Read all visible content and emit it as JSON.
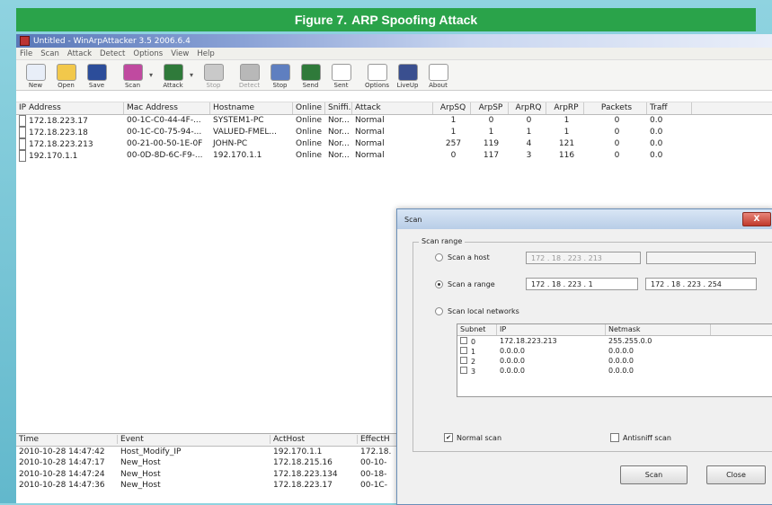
{
  "figure": {
    "label": "Figure 7.",
    "title": "ARP Spoofing Attack"
  },
  "app": {
    "title": "Untitled - WinArpAttacker 3.5 2006.6.4",
    "menu": [
      "File",
      "Scan",
      "Attack",
      "Detect",
      "Options",
      "View",
      "Help"
    ],
    "toolbar": [
      {
        "label": "New",
        "icon": "new-icon",
        "color": "#e8eef8"
      },
      {
        "label": "Open",
        "icon": "open-folder-icon",
        "color": "#f2c84b"
      },
      {
        "label": "Save",
        "icon": "save-icon",
        "color": "#2c4d9a"
      },
      {
        "label": "Scan",
        "icon": "scan-icon",
        "color": "#c04aa0"
      },
      {
        "label": "Attack",
        "icon": "attack-icon",
        "color": "#2f7a3a"
      },
      {
        "label": "Stop",
        "icon": "stop-icon",
        "color": "#c9c9c9"
      },
      {
        "label": "Detect",
        "icon": "detect-icon",
        "color": "#b8b8b8"
      },
      {
        "label": "Stop",
        "icon": "stop-detect-icon",
        "color": "#5f7fc0"
      },
      {
        "label": "Send",
        "icon": "send-icon",
        "color": "#2f7a3a"
      },
      {
        "label": "Sent",
        "icon": "sent-icon",
        "color": "#ffffff"
      },
      {
        "label": "Options",
        "icon": "options-icon",
        "color": "#ffffff"
      },
      {
        "label": "LiveUp",
        "icon": "liveup-icon",
        "color": "#3a4f8f"
      },
      {
        "label": "About",
        "icon": "about-icon",
        "color": "#ffffff"
      }
    ]
  },
  "hosts": {
    "columns": [
      "IP Address",
      "Mac Address",
      "Hostname",
      "Online",
      "Sniffi...",
      "Attack",
      "ArpSQ",
      "ArpSP",
      "ArpRQ",
      "ArpRP",
      "Packets",
      "Traff"
    ],
    "rows": [
      {
        "ip": "172.18.223.17",
        "mac": "00-1C-C0-44-4F-...",
        "host": "SYSTEM1-PC",
        "online": "Online",
        "sniff": "Nor...",
        "attack": "Normal",
        "sq": "1",
        "sp": "0",
        "rq": "0",
        "rp": "1",
        "pk": "0",
        "tr": "0.0"
      },
      {
        "ip": "172.18.223.18",
        "mac": "00-1C-C0-75-94-...",
        "host": "VALUED-FMEL...",
        "online": "Online",
        "sniff": "Nor...",
        "attack": "Normal",
        "sq": "1",
        "sp": "1",
        "rq": "1",
        "rp": "1",
        "pk": "0",
        "tr": "0.0"
      },
      {
        "ip": "172.18.223.213",
        "mac": "00-21-00-50-1E-0F",
        "host": "JOHN-PC",
        "online": "Online",
        "sniff": "Nor...",
        "attack": "Normal",
        "sq": "257",
        "sp": "119",
        "rq": "4",
        "rp": "121",
        "pk": "0",
        "tr": "0.0"
      },
      {
        "ip": "192.170.1.1",
        "mac": "00-0D-8D-6C-F9-...",
        "host": "192.170.1.1",
        "online": "Online",
        "sniff": "Nor...",
        "attack": "Normal",
        "sq": "0",
        "sp": "117",
        "rq": "3",
        "rp": "116",
        "pk": "0",
        "tr": "0.0"
      }
    ]
  },
  "events": {
    "columns": [
      "Time",
      "Event",
      "ActHost",
      "EffectH"
    ],
    "rows": [
      {
        "time": "2010-10-28 14:47:42",
        "event": "Host_Modify_IP",
        "act": "192.170.1.1",
        "eff": "172.18."
      },
      {
        "time": "2010-10-28 14:47:17",
        "event": "New_Host",
        "act": "172.18.215.16",
        "eff": "00-10-"
      },
      {
        "time": "2010-10-28 14:47:24",
        "event": "New_Host",
        "act": "172.18.223.134",
        "eff": "00-18-"
      },
      {
        "time": "2010-10-28 14:47:36",
        "event": "New_Host",
        "act": "172.18.223.17",
        "eff": "00-1C-"
      }
    ]
  },
  "scan_dialog": {
    "title": "Scan",
    "close_label": "X",
    "group_label": "Scan range",
    "scan_host_label": "Scan a host",
    "scan_host_ip": "172 . 18 . 223 . 213",
    "scan_host_extra": "",
    "scan_range_label": "Scan a range",
    "range_from": "172 . 18 . 223 . 1",
    "range_to": "172 . 18 . 223 . 254",
    "scan_local_label": "Scan local networks",
    "subnet_columns": [
      "Subnet",
      "IP",
      "Netmask"
    ],
    "subnets": [
      {
        "id": "0",
        "ip": "172.18.223.213",
        "mask": "255.255.0.0"
      },
      {
        "id": "1",
        "ip": "0.0.0.0",
        "mask": "0.0.0.0"
      },
      {
        "id": "2",
        "ip": "0.0.0.0",
        "mask": "0.0.0.0"
      },
      {
        "id": "3",
        "ip": "0.0.0.0",
        "mask": "0.0.0.0"
      }
    ],
    "normal_scan_label": "Normal scan",
    "antisniff_label": "Antisniff scan",
    "scan_button": "Scan",
    "close_button": "Close"
  }
}
